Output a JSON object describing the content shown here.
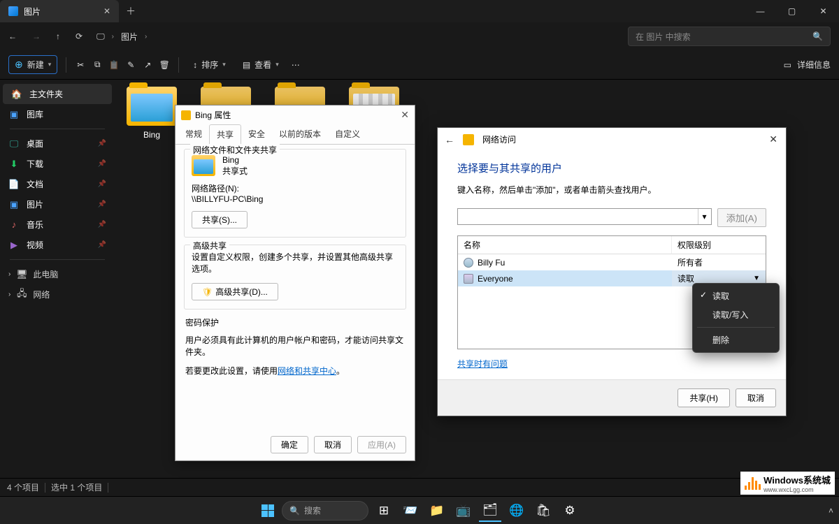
{
  "titlebar": {
    "tab_title": "图片"
  },
  "breadcrumb": {
    "icon": "monitor",
    "item1": "图片"
  },
  "search": {
    "placeholder": "在 图片 中搜索"
  },
  "toolbar": {
    "new": "新建",
    "sort": "排序",
    "view": "查看",
    "details": "详细信息"
  },
  "sidebar": {
    "home": "主文件夹",
    "gallery": "图库",
    "desktop": "桌面",
    "downloads": "下载",
    "documents": "文档",
    "pictures": "图片",
    "music": "音乐",
    "videos": "视频",
    "thispc": "此电脑",
    "network": "网络"
  },
  "folders": {
    "bing": "Bing"
  },
  "status": {
    "count": "4 个项目",
    "selected": "选中 1 个项目"
  },
  "taskbar": {
    "search": "搜索"
  },
  "props": {
    "title": "Bing 属性",
    "tabs": {
      "general": "常规",
      "sharing": "共享",
      "security": "安全",
      "prev": "以前的版本",
      "custom": "自定义"
    },
    "section1_title": "网络文件和文件夹共享",
    "folder_name": "Bing",
    "shared_status": "共享式",
    "path_label": "网络路径(N):",
    "path_value": "\\\\BILLYFU-PC\\Bing",
    "share_btn": "共享(S)...",
    "section2_title": "高级共享",
    "section2_desc": "设置自定义权限，创建多个共享，并设置其他高级共享选项。",
    "adv_btn": "高级共享(D)...",
    "section3_title": "密码保护",
    "section3_line1": "用户必须具有此计算机的用户帐户和密码，才能访问共享文件夹。",
    "section3_line2a": "若要更改此设置，请使用",
    "section3_link": "网络和共享中心",
    "section3_line2b": "。",
    "ok": "确定",
    "cancel": "取消",
    "apply": "应用(A)"
  },
  "net": {
    "title": "网络访问",
    "h1": "选择要与其共享的用户",
    "desc": "键入名称，然后单击\"添加\"，或者单击箭头查找用户。",
    "add": "添加(A)",
    "col_name": "名称",
    "col_perm": "权限级别",
    "user1": "Billy Fu",
    "perm1": "所有者",
    "user2": "Everyone",
    "perm2": "读取",
    "problem_link": "共享时有问题",
    "share_btn": "共享(H)",
    "cancel_btn": "取消"
  },
  "ctx": {
    "read": "读取",
    "readwrite": "读取/写入",
    "delete": "删除"
  },
  "watermark": {
    "brand": "Windows系统城",
    "url": "www.wxcLgg.com"
  }
}
